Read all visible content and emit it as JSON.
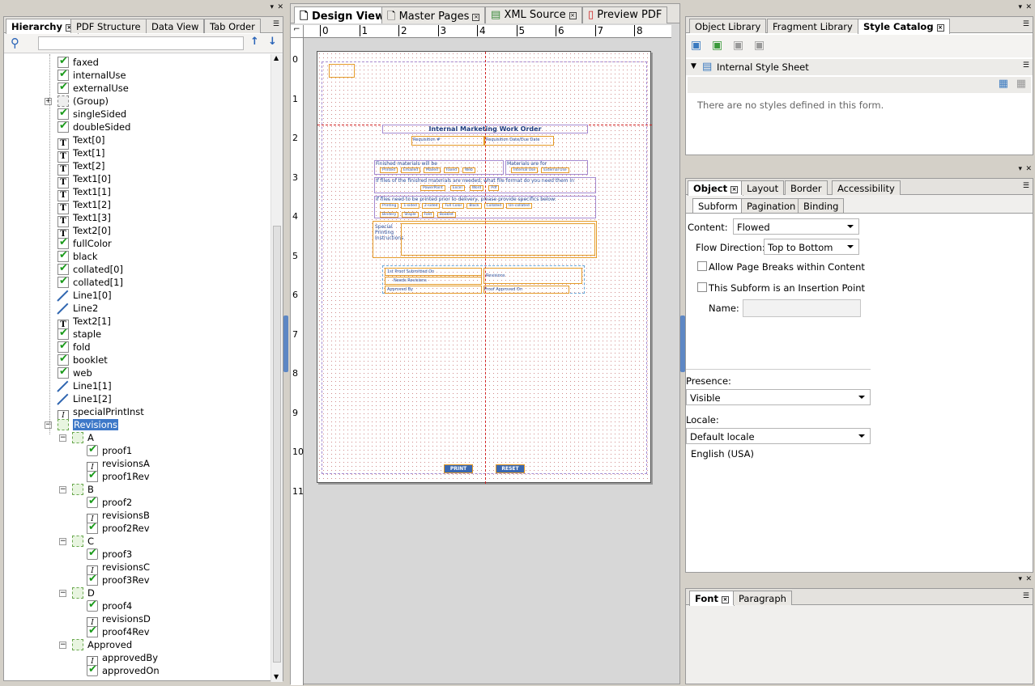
{
  "left_panel": {
    "tabs": [
      {
        "label": "Hierarchy"
      },
      {
        "label": "PDF Structure"
      },
      {
        "label": "Data View"
      },
      {
        "label": "Tab Order"
      }
    ],
    "search_placeholder": "",
    "tree": [
      {
        "label": "faxed",
        "icon": "checkbox-icon"
      },
      {
        "label": "internalUse",
        "icon": "checkbox-icon"
      },
      {
        "label": "externalUse",
        "icon": "checkbox-icon"
      },
      {
        "label": "(Group)",
        "icon": "group-icon"
      },
      {
        "label": "singleSided",
        "icon": "checkbox-icon"
      },
      {
        "label": "doubleSided",
        "icon": "checkbox-icon"
      },
      {
        "label": "Text[0]",
        "icon": "text-icon"
      },
      {
        "label": "Text[1]",
        "icon": "text-icon"
      },
      {
        "label": "Text[2]",
        "icon": "text-icon"
      },
      {
        "label": "Text1[0]",
        "icon": "text-icon"
      },
      {
        "label": "Text1[1]",
        "icon": "text-icon"
      },
      {
        "label": "Text1[2]",
        "icon": "text-icon"
      },
      {
        "label": "Text1[3]",
        "icon": "text-icon"
      },
      {
        "label": "Text2[0]",
        "icon": "text-icon"
      },
      {
        "label": "fullColor",
        "icon": "checkbox-icon"
      },
      {
        "label": "black",
        "icon": "checkbox-icon"
      },
      {
        "label": "collated[0]",
        "icon": "checkbox-icon"
      },
      {
        "label": "collated[1]",
        "icon": "checkbox-icon"
      },
      {
        "label": "Line1[0]",
        "icon": "line-icon"
      },
      {
        "label": "Line2",
        "icon": "line-icon"
      },
      {
        "label": "Text2[1]",
        "icon": "text-icon"
      },
      {
        "label": "staple",
        "icon": "checkbox-icon"
      },
      {
        "label": "fold",
        "icon": "checkbox-icon"
      },
      {
        "label": "booklet",
        "icon": "checkbox-icon"
      },
      {
        "label": "web",
        "icon": "checkbox-icon"
      },
      {
        "label": "Line1[1]",
        "icon": "line-icon"
      },
      {
        "label": "Line1[2]",
        "icon": "line-icon"
      },
      {
        "label": "specialPrintInst",
        "icon": "textfield-icon"
      },
      {
        "label": "Revisions",
        "icon": "subform-icon"
      },
      {
        "label": "A",
        "icon": "subform-icon"
      },
      {
        "label": "proof1",
        "icon": "datefield-icon"
      },
      {
        "label": "revisionsA",
        "icon": "textfield-icon"
      },
      {
        "label": "proof1Rev",
        "icon": "checkbox-icon"
      },
      {
        "label": "B",
        "icon": "subform-icon"
      },
      {
        "label": "proof2",
        "icon": "datefield-icon"
      },
      {
        "label": "revisionsB",
        "icon": "textfield-icon"
      },
      {
        "label": "proof2Rev",
        "icon": "checkbox-icon"
      },
      {
        "label": "C",
        "icon": "subform-icon"
      },
      {
        "label": "proof3",
        "icon": "datefield-icon"
      },
      {
        "label": "revisionsC",
        "icon": "textfield-icon"
      },
      {
        "label": "proof3Rev",
        "icon": "checkbox-icon"
      },
      {
        "label": "D",
        "icon": "subform-icon"
      },
      {
        "label": "proof4",
        "icon": "datefield-icon"
      },
      {
        "label": "revisionsD",
        "icon": "textfield-icon"
      },
      {
        "label": "proof4Rev",
        "icon": "checkbox-icon"
      },
      {
        "label": "Approved",
        "icon": "subform-icon"
      },
      {
        "label": "approvedBy",
        "icon": "textfield-icon"
      },
      {
        "label": "approvedOn",
        "icon": "datefield-icon"
      }
    ]
  },
  "center": {
    "tabs": [
      {
        "label": "Design View"
      },
      {
        "label": "Master Pages"
      },
      {
        "label": "XML Source"
      },
      {
        "label": "Preview PDF"
      }
    ],
    "ruler_h": [
      "0",
      "1",
      "2",
      "3",
      "4",
      "5",
      "6",
      "7",
      "8"
    ],
    "ruler_v": [
      "0",
      "1",
      "2",
      "3",
      "4",
      "5",
      "6",
      "7",
      "8",
      "9",
      "10",
      "11"
    ],
    "form": {
      "title": "Internal Marketing Work Order",
      "req_label": "Requisition #",
      "req_date_label": "Requisition Date/Due Date",
      "finished_label": "Finished materials will be",
      "materials_for_label": "Materials are for",
      "opts1": [
        "Printed",
        "Emailed",
        "Mailed",
        "Faxed",
        "Web"
      ],
      "opts2": [
        "Internal Use",
        "External Use"
      ],
      "files_label": "If files of the finished materials are needed, what file format do you need them in",
      "file_opts": [
        "PowerPoint",
        "Excel",
        "Word",
        "Pdf"
      ],
      "print_label": "If files need to be printed prior to delivery, please provide specifics below:",
      "print_opts": [
        "Printing",
        "1-sided",
        "2-sided",
        "Full Color",
        "Black",
        "Collated",
        "Un-collated"
      ],
      "bind_opts": [
        "Bindery",
        "Staple",
        "Fold",
        "Booklet"
      ],
      "special_label": "Special Printing Instructions",
      "proof_label": "1st Proof Submitted On",
      "needs_label": "Needs Revisions",
      "revisions_label": "Revisions",
      "approved_by_label": "Approved By",
      "proof_approved_label": "Proof Approved On",
      "print_button": "PRINT",
      "reset_button": "RESET"
    }
  },
  "right_top": {
    "tabs": [
      {
        "label": "Object Library"
      },
      {
        "label": "Fragment Library"
      },
      {
        "label": "Style Catalog"
      }
    ],
    "sheet_label": "Internal Style Sheet",
    "empty_text": "There are no styles defined in this form."
  },
  "right_mid": {
    "tabs": [
      {
        "label": "Object"
      },
      {
        "label": "Layout"
      },
      {
        "label": "Border"
      },
      {
        "label": "Accessibility"
      }
    ],
    "subtabs": [
      {
        "label": "Subform"
      },
      {
        "label": "Pagination"
      },
      {
        "label": "Binding"
      }
    ],
    "content_label": "Content:",
    "content_value": "Flowed",
    "flow_label": "Flow Direction:",
    "flow_value": "Top to Bottom",
    "allow_breaks_label": "Allow Page Breaks within Content",
    "insertion_label": "This Subform is an Insertion Point",
    "name_label": "Name:",
    "presence_label": "Presence:",
    "presence_value": "Visible",
    "locale_label": "Locale:",
    "locale_value": "Default locale",
    "locale_text": "English (USA)"
  },
  "right_bottom": {
    "tabs": [
      {
        "label": "Font"
      },
      {
        "label": "Paragraph"
      }
    ]
  }
}
